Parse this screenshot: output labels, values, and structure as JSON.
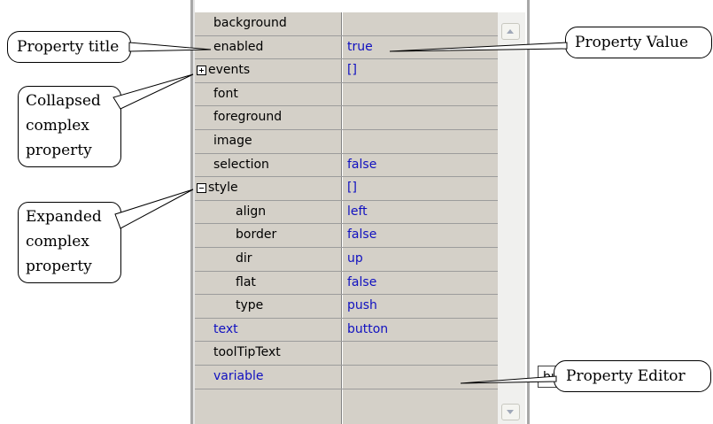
{
  "properties": [
    {
      "name": "background",
      "value": "",
      "level": 0,
      "toggle": "",
      "blue": false
    },
    {
      "name": "enabled",
      "value": "true",
      "level": 0,
      "toggle": "",
      "blue": false
    },
    {
      "name": "events",
      "value": "[]",
      "level": 0,
      "toggle": "plus",
      "blue": false
    },
    {
      "name": "font",
      "value": "",
      "level": 0,
      "toggle": "",
      "blue": false
    },
    {
      "name": "foreground",
      "value": "",
      "level": 0,
      "toggle": "",
      "blue": false
    },
    {
      "name": "image",
      "value": "",
      "level": 0,
      "toggle": "",
      "blue": false
    },
    {
      "name": "selection",
      "value": "false",
      "level": 0,
      "toggle": "",
      "blue": false
    },
    {
      "name": "style",
      "value": "[]",
      "level": 0,
      "toggle": "minus",
      "blue": false
    },
    {
      "name": "align",
      "value": "left",
      "level": 1,
      "toggle": "",
      "blue": false
    },
    {
      "name": "border",
      "value": "false",
      "level": 1,
      "toggle": "",
      "blue": false
    },
    {
      "name": "dir",
      "value": "up",
      "level": 1,
      "toggle": "",
      "blue": false
    },
    {
      "name": "flat",
      "value": "false",
      "level": 1,
      "toggle": "",
      "blue": false
    },
    {
      "name": "type",
      "value": "push",
      "level": 1,
      "toggle": "",
      "blue": false
    },
    {
      "name": "text",
      "value": "button",
      "level": 0,
      "toggle": "",
      "blue": true
    },
    {
      "name": "toolTipText",
      "value": "",
      "level": 0,
      "toggle": "",
      "blue": false
    },
    {
      "name": "variable",
      "value": "button",
      "level": 0,
      "toggle": "",
      "blue": true,
      "editing": true
    }
  ],
  "callouts": {
    "property_title": "Property title",
    "collapsed": [
      "Collapsed",
      "complex",
      "property"
    ],
    "expanded": [
      "Expanded",
      "complex",
      "property"
    ],
    "property_value": "Property Value",
    "property_editor": "Property Editor"
  },
  "colors": {
    "grid_background": "#d4d0c8",
    "value_text": "#1010c0",
    "editor_background": "#ffffff"
  },
  "icons": {
    "expand": "plus-box-icon",
    "collapse": "minus-box-icon",
    "scroll_up": "chevron-up-icon",
    "scroll_down": "chevron-down-icon"
  }
}
